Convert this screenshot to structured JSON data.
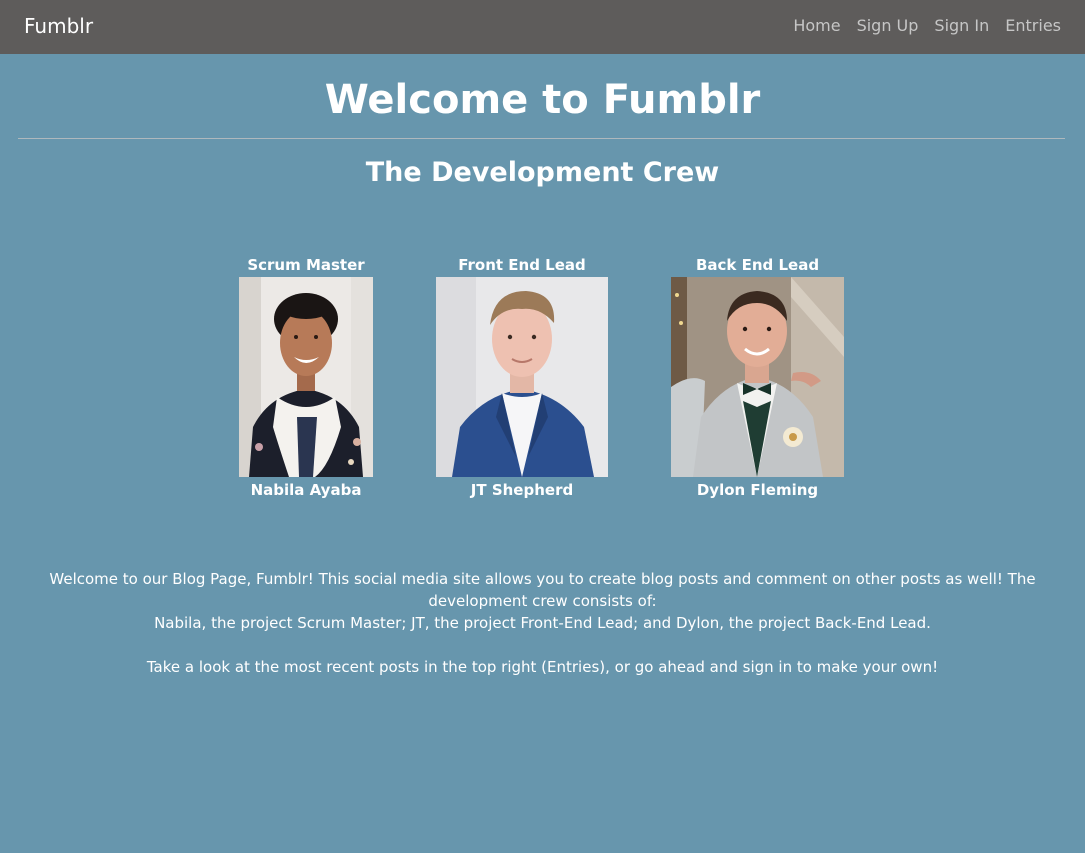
{
  "navbar": {
    "brand": "Fumblr",
    "links": [
      "Home",
      "Sign Up",
      "Sign In",
      "Entries"
    ]
  },
  "main": {
    "title": "Welcome to Fumblr",
    "crew_heading": "The Development Crew",
    "members": [
      {
        "role": "Scrum Master",
        "name": "Nabila Ayaba"
      },
      {
        "role": "Front End Lead",
        "name": "JT Shepherd"
      },
      {
        "role": "Back End Lead",
        "name": "Dylon Fleming"
      }
    ],
    "intro_line1": "Welcome to our Blog Page, Fumblr! This social media site allows you to create blog posts and comment on other posts as well! The development crew consists of:",
    "intro_line2": "Nabila, the project Scrum Master; JT, the project Front-End Lead; and Dylon, the project Back-End Lead.",
    "call_to_action": "Take a look at the most recent posts in the top right (Entries), or go ahead and sign in to make your own!"
  },
  "colors": {
    "page_background": "#6796ad",
    "navbar_background": "#5e5c5b",
    "nav_link": "#c6c6c6",
    "text": "#ffffff"
  }
}
